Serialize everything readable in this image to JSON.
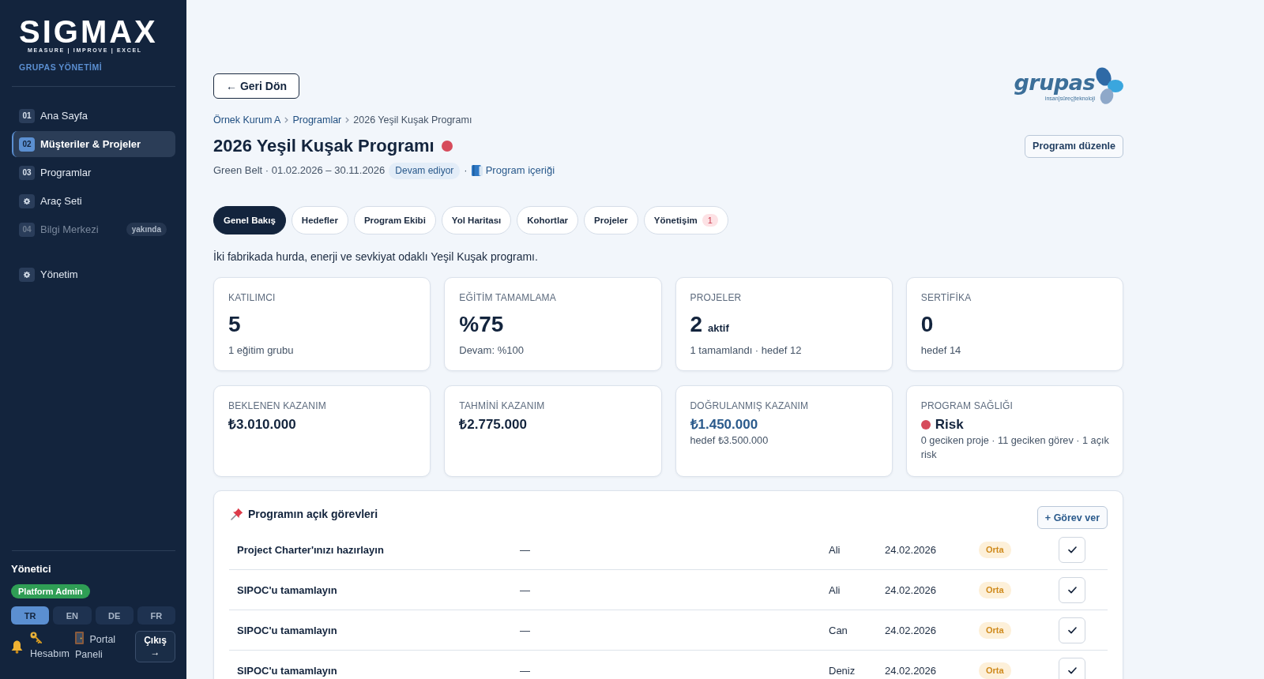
{
  "sidebar": {
    "logo": {
      "wordmark": "SIGMAX",
      "tagline": "MEASURE | IMPROVE | EXCEL"
    },
    "org_name": "GRUPAS YÖNETİMİ",
    "nav": [
      {
        "kind": "numbered",
        "number": "01",
        "label": "Ana Sayfa",
        "selected": false,
        "disabled": false
      },
      {
        "kind": "numbered",
        "number": "02",
        "label": "Müşteriler & Projeler",
        "selected": true,
        "disabled": false
      },
      {
        "kind": "numbered",
        "number": "03",
        "label": "Programlar",
        "selected": false,
        "disabled": false
      },
      {
        "kind": "tool",
        "label": "Araç Seti",
        "selected": false,
        "disabled": false
      },
      {
        "kind": "numbered",
        "number": "04",
        "label": "Bilgi Merkezi",
        "badge": "yakında",
        "selected": false,
        "disabled": true
      }
    ],
    "admin_nav": [
      {
        "kind": "tool",
        "label": "Yönetim",
        "selected": false,
        "disabled": false
      }
    ],
    "user": {
      "role": "Yönetici",
      "badge": "Platform Admin"
    },
    "languages": [
      {
        "label": "TR",
        "selected": true
      },
      {
        "label": "EN",
        "selected": false
      },
      {
        "label": "DE",
        "selected": false
      },
      {
        "label": "FR",
        "selected": false
      }
    ],
    "footer": {
      "account_link": "Hesabım",
      "portal_link": "Portal Paneli",
      "logout_button": "Çıkış →"
    }
  },
  "header": {
    "back_button": "← Geri Dön",
    "brand_logo": {
      "wordmark": "grupas",
      "tagline": "insan|süreç|teknoloji"
    }
  },
  "breadcrumb": [
    {
      "label": "Örnek Kurum A",
      "link": true
    },
    {
      "label": "Programlar",
      "link": true
    },
    {
      "label": "2026 Yeşil Kuşak Programı",
      "link": false
    }
  ],
  "program": {
    "title": "2026 Yeşil Kuşak Programı",
    "at_risk": true,
    "summary": "Green Belt · 01.02.2026 – 30.11.2026",
    "status_badge": "Devam ediyor",
    "separator": "·",
    "content_link": "Program içeriği",
    "edit_button": "Programı düzenle"
  },
  "tabs": [
    {
      "label": "Genel Bakış",
      "selected": true
    },
    {
      "label": "Hedefler",
      "selected": false
    },
    {
      "label": "Program Ekibi",
      "selected": false
    },
    {
      "label": "Yol Haritası",
      "selected": false
    },
    {
      "label": "Kohortlar",
      "selected": false
    },
    {
      "label": "Projeler",
      "selected": false
    },
    {
      "label": "Yönetişim",
      "selected": false,
      "count": "1"
    }
  ],
  "description": "İki fabrikada hurda, enerji ve sevkiyat odaklı Yeşil Kuşak programı.",
  "stats": [
    {
      "label": "KATILIMCI",
      "value": "5",
      "note": "1 eğitim grubu"
    },
    {
      "label": "EĞİTİM TAMAMLAMA",
      "value": "%75",
      "note": "Devam: %100"
    },
    {
      "label": "PROJELER",
      "value": "2",
      "unit": "aktif",
      "note": "1 tamamlandı · hedef 12"
    },
    {
      "label": "SERTİFİKA",
      "value": "0",
      "note": "hedef 14"
    }
  ],
  "gains": [
    {
      "kind": "amount",
      "label": "BEKLENEN KAZANIM",
      "value": "₺3.010.000"
    },
    {
      "kind": "amount",
      "label": "TAHMİNİ KAZANIM",
      "value": "₺2.775.000"
    },
    {
      "kind": "verified",
      "label": "DOĞRULANMIŞ KAZANIM",
      "value": "₺1.450.000",
      "note": "hedef ₺3.500.000"
    },
    {
      "kind": "health",
      "label": "PROGRAM SAĞLIĞI",
      "at_risk": true,
      "value": "Risk",
      "note": "0 geciken proje · 11 geciken görev · 1 açık risk"
    }
  ],
  "tasks": {
    "title": "Programın açık görevleri",
    "add_button": "+ Görev ver",
    "rows": [
      {
        "title": "Project Charter'ınızı hazırlayın",
        "project": "—",
        "assignee": "Ali",
        "due": "24.02.2026",
        "priority": "Orta"
      },
      {
        "title": "SIPOC'u tamamlayın",
        "project": "—",
        "assignee": "Ali",
        "due": "24.02.2026",
        "priority": "Orta"
      },
      {
        "title": "SIPOC'u tamamlayın",
        "project": "—",
        "assignee": "Can",
        "due": "24.02.2026",
        "priority": "Orta"
      },
      {
        "title": "SIPOC'u tamamlayın",
        "project": "—",
        "assignee": "Deniz",
        "due": "24.02.2026",
        "priority": "Orta"
      }
    ]
  }
}
